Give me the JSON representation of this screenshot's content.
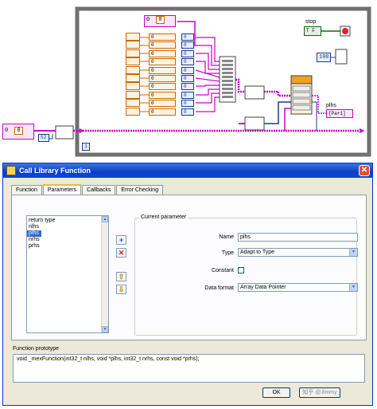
{
  "diagram": {
    "stop_label": "stop",
    "stop_bool": "T F",
    "wait_value": "100",
    "numeric_top": "0",
    "numeric_top_idx": "0",
    "numeric_left": "0",
    "numeric_left_idx": "0",
    "array_size": "52",
    "iteration_terminal": "i",
    "index_items": [
      "0",
      "0",
      "0",
      "0",
      "0",
      "0",
      "0",
      "0",
      "0",
      "0"
    ],
    "index_label": "0",
    "plhs_label": "plhs",
    "plhs_indicator": "[Pa+1]",
    "clf_node": "f"
  },
  "dialog": {
    "title": "Call Library Function",
    "close": "✕",
    "tabs": [
      "Function",
      "Parameters",
      "Callbacks",
      "Error Checking"
    ],
    "active_tab": 1,
    "params": [
      "return type",
      "nlhs",
      "plhs",
      "nrhs",
      "prhs"
    ],
    "selected_param": "plhs",
    "add_button": "+",
    "remove_button": "✕",
    "up_button": "⇧",
    "down_button": "⇩",
    "current_parameter_label": "Current parameter",
    "name_label": "Name",
    "name_value": "plhs",
    "type_label": "Type",
    "type_value": "Adapt to Type",
    "constant_label": "Constant",
    "data_format_label": "Data format",
    "data_format_value": "Array Data Pointer",
    "prototype_label": "Function prototype",
    "prototype_text": "void  _mexFunction(int32_t nlhs, void *plhs, int32_t nrhs, const void *prhs);",
    "ok_label": "OK",
    "cancel_label": "Cancel",
    "watermark": "知乎 @Jimmy"
  },
  "colors": {
    "wire_pink": "#cc00cc",
    "wire_blue": "#1a3a8a",
    "wire_orange": "#cc6600",
    "wire_green": "#0a6b0a",
    "title_blue": "#0a3fc4",
    "selection": "#316ac5"
  }
}
